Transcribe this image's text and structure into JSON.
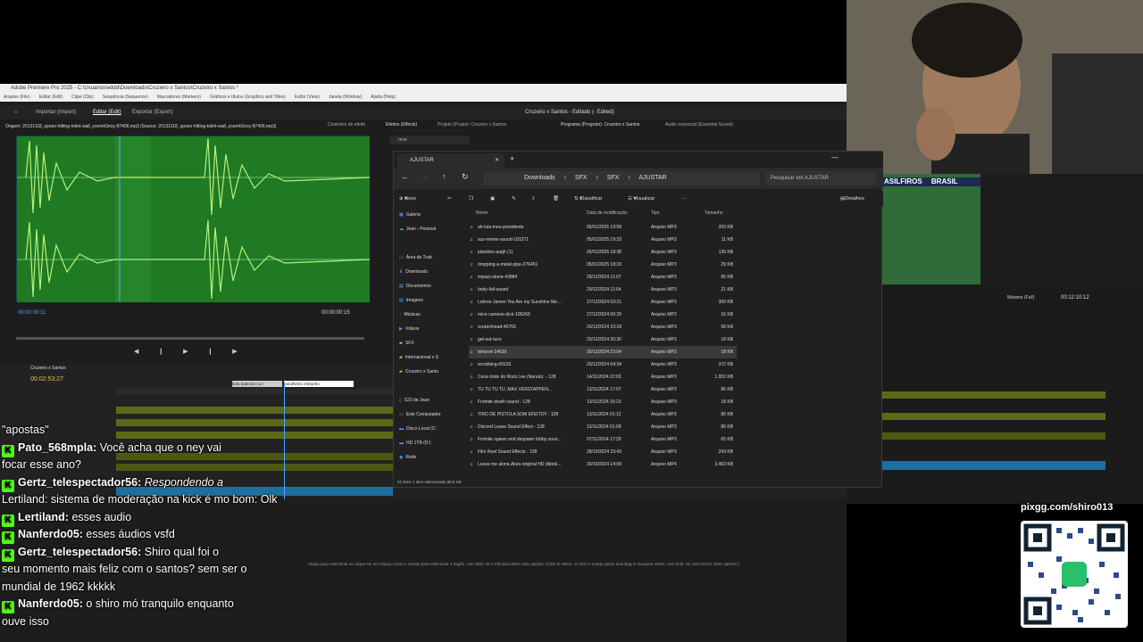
{
  "premiere": {
    "title": "Adobe Premiere Pro 2025 - C:\\Usuarios\\eddd\\Downloads\\Cruzeiro x Santos\\Cruzeiro x Santos *",
    "menu": [
      "Arquivo (File)",
      "Editar (Edit)",
      "Clipe (Clip)",
      "Sequência (Sequence)",
      "Marcadores (Markers)",
      "Gráficos e títulos (Graphics and Titles)",
      "Exibir (View)",
      "Janela (Window)",
      "Ajuda (Help)"
    ],
    "workspace_tabs": [
      "Importar (Import)",
      "Editar (Edit)",
      "Exportar (Export)"
    ],
    "doc_title": "Cruzeiro x Santos - Editado (- Edited)",
    "source_tab": "Origem: 20131118_spoon-hitting-toilet-wall_zoomh2esy-87406.mp3 (Source: 20131118_spoon-hitting-toilet-wall_zoomh2esy-87406.mp3)",
    "effect_controls": "Controles de efeito",
    "effects_tab": "Efeitos (Effects)",
    "project_tab": "Projeto (Project: Cruzeiro x Santos",
    "program_tab": "Programa (Program): Cruzeiro x Santos",
    "essential_sound": "Áudio essencial (Essential Sound)",
    "src_time_left": "00:00:00:11",
    "src_time_right": "00:00:00:15",
    "timeline_title": "Cruzeiro x Santos",
    "timeline_time": "00:02:53:27",
    "prog_time": "00:12:10:12",
    "prog_fit": "Máximo (Full)",
    "hint": "Clique para selecionar ou clique em um espaço vazio e arraste para selecionar a região. Use Shift, Alt e Ctrl para obter mais opções. (Click to select, or click in empty space and drag to marquee select. Use Shift, Alt, and Ctrl for other options.)",
    "clip_label1": "bola batendo na t",
    "clip_label2": "barulhinho estranho",
    "broadcast_text": "BRASIL",
    "broadcast_text2": "ASILFIROS",
    "prog_search": "reve"
  },
  "explorer": {
    "tab_title": "AJUSTAR",
    "breadcrumb": [
      "Downloads",
      "SFX",
      "SFX",
      "AJUSTAR"
    ],
    "search_placeholder": "Pesquisar em AJUSTAR",
    "toolbar": {
      "new": "Novo",
      "sort": "Classificar",
      "view": "Visualizar",
      "details": "Detalhes"
    },
    "nav": [
      {
        "label": "Galeria",
        "icon": "gallery-icon"
      },
      {
        "label": "Jean - Pessoal",
        "icon": "cloud-icon"
      },
      {
        "label": "Área de Trab",
        "icon": "desktop-icon"
      },
      {
        "label": "Downloads",
        "icon": "download-icon"
      },
      {
        "label": "Documentos",
        "icon": "document-icon"
      },
      {
        "label": "Imagens",
        "icon": "image-icon"
      },
      {
        "label": "Músicas",
        "icon": "music-icon"
      },
      {
        "label": "Vídeos",
        "icon": "video-icon"
      },
      {
        "label": "SFX",
        "icon": "folder-icon"
      },
      {
        "label": "Internacional x S",
        "icon": "folder-icon"
      },
      {
        "label": "Cruzeiro x Santo",
        "icon": "folder-icon"
      },
      {
        "label": "S23 de Jean",
        "icon": "phone-icon"
      },
      {
        "label": "Este Computador",
        "icon": "computer-icon"
      },
      {
        "label": "Disco Local (C:",
        "icon": "drive-icon"
      },
      {
        "label": "HD 1TB (D:)",
        "icon": "drive-icon"
      },
      {
        "label": "Rede",
        "icon": "network-icon"
      }
    ],
    "columns": [
      "Nome",
      "Data de modificação",
      "Tipo",
      "Tamanho"
    ],
    "files": [
      {
        "name": "ah-lula-meu-presidente",
        "date": "05/01/2025 19:58",
        "type": "Arquivo MP3",
        "size": "203 KB"
      },
      {
        "name": "sus-meme-sound-181271",
        "date": "05/01/2025 19:33",
        "type": "Arquivo MP3",
        "size": "11 KB"
      },
      {
        "name": "plankton-augh (1)",
        "date": "05/01/2025 18:38",
        "type": "Arquivo MP3",
        "size": "135 KB"
      },
      {
        "name": "dropping-a-metal-pipe-276451",
        "date": "05/01/2025 18:33",
        "type": "Arquivo MP3",
        "size": "29 KB"
      },
      {
        "name": "impact-stone-43884",
        "date": "29/12/2024 11:07",
        "type": "Arquivo MP3",
        "size": "95 KB"
      },
      {
        "name": "body-fall-sound",
        "date": "29/12/2024 11:04",
        "type": "Arquivo MP3",
        "size": "21 KB"
      },
      {
        "name": "Lebron James You Are my Sunshine Me...",
        "date": "27/12/2024 03:21",
        "type": "Arquivo MP3",
        "size": "309 KB"
      },
      {
        "name": "mice-camera-click-106269",
        "date": "27/12/2024 00:29",
        "type": "Arquivo MP3",
        "size": "16 KB"
      },
      {
        "name": "scratchhead-45755",
        "date": "20/12/2024 23:18",
        "type": "Arquivo MP3",
        "size": "58 KB"
      },
      {
        "name": "get-out-tuco",
        "date": "20/12/2024 20:30",
        "type": "Arquivo MP3",
        "size": "18 KB"
      },
      {
        "name": "teleport-14639",
        "date": "20/12/2024 23:04",
        "type": "Arquivo MP3",
        "size": "18 KB"
      },
      {
        "name": "scrubbing-69126",
        "date": "20/12/2024 04:34",
        "type": "Arquivo MP3",
        "size": "372 KB"
      },
      {
        "name": "Cena triste do Rock Lee (Naruto). - 128",
        "date": "14/11/2024 22:02",
        "type": "Arquivo MP3",
        "size": "1.002 KB"
      },
      {
        "name": "TU TU TU TU, MAX VERSTAPPEN...",
        "date": "13/11/2024 17:07",
        "type": "Arquivo MP3",
        "size": "86 KB"
      },
      {
        "name": "Fortnite death sound - 128",
        "date": "13/11/2024 16:23",
        "type": "Arquivo MP3",
        "size": "18 KB"
      },
      {
        "name": "TIRO DE PISTOLA SOM EFEITO!! - 128",
        "date": "13/11/2024 01:12",
        "type": "Arquivo MP3",
        "size": "80 KB"
      },
      {
        "name": "Discord Leave Sound Effect - 128",
        "date": "13/11/2024 01:09",
        "type": "Arquivo MP3",
        "size": "80 KB"
      },
      {
        "name": "Fortnite spawn and despawn lobby soun...",
        "date": "07/11/2024 17:29",
        "type": "Arquivo MP3",
        "size": "65 KB"
      },
      {
        "name": "Film Reel Sound Effects - 128",
        "date": "28/10/2024 23:43",
        "type": "Arquivo MP3",
        "size": "243 KB"
      },
      {
        "name": "Leave me alone,Akira original HD (tiktok...",
        "date": "20/10/2024 14:09",
        "type": "Arquivo MP4",
        "size": "3.463 KB"
      }
    ],
    "selected_index": 10,
    "status": "61 itens   1 item selecionado  86,6 KB"
  },
  "chat": [
    {
      "user": "",
      "text": "\"apostas\"",
      "cont": true
    },
    {
      "user": "Pato_568mpla",
      "text": "Você acha que o ney vai"
    },
    {
      "user": "",
      "text": "focar esse ano?",
      "cont": true
    },
    {
      "user": "Gertz_telespectador56",
      "text": "Respondendo a",
      "italic": true
    },
    {
      "user": "",
      "text": "Lertiland: sistema de moderação na kick é mo bom: Olk",
      "cont": true
    },
    {
      "user": "Lertiland",
      "text": "esses audio"
    },
    {
      "user": "Nanferdo05",
      "text": "esses áudios vsfd"
    },
    {
      "user": "Gertz_telespectador56",
      "text": "Shiro qual foi o"
    },
    {
      "user": "",
      "text": "seu momento mais feliz com o santos? sem ser o",
      "cont": true
    },
    {
      "user": "",
      "text": "mundial de 1962 kkkkk",
      "cont": true
    },
    {
      "user": "Nanferdo05",
      "text": "o shiro mó tranquilo enquanto"
    },
    {
      "user": "",
      "text": "ouve isso",
      "cont": true
    }
  ],
  "qr": {
    "url": "pixgg.com/shiro013"
  }
}
